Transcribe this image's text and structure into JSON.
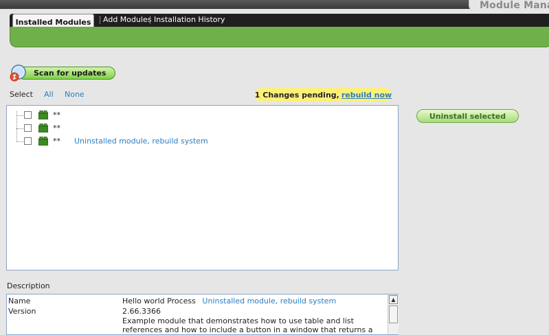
{
  "window": {
    "title": "Module Manag"
  },
  "tabs": {
    "active": "Installed Modules",
    "add": "Add Modules",
    "history": "Installation History"
  },
  "toolbar": {
    "scan_label": "Scan for updates"
  },
  "select": {
    "label": "Select",
    "all": "All",
    "none": "None"
  },
  "pending": {
    "text": "1 Changes pending,",
    "rebuild": "rebuild now"
  },
  "tree": {
    "rows": [
      {
        "name": "**",
        "status": ""
      },
      {
        "name": "**",
        "status": ""
      },
      {
        "name": "**",
        "status": "Uninstalled module, rebuild system"
      }
    ]
  },
  "actions": {
    "uninstall_label": "Uninstall selected"
  },
  "description": {
    "label": "Description",
    "name_key": "Name",
    "name_value": "Hello world Process",
    "name_status": "Uninstalled module, rebuild system",
    "version_key": "Version",
    "version_value": "2.66.3366",
    "text": "Example module that demonstrates how to use table and list references and how to include a button in a window that returns a message. The objective is to"
  },
  "colors": {
    "accent_green": "#70b04a",
    "link_blue": "#2a7dc0",
    "pending_yellow": "#fdf07a"
  }
}
